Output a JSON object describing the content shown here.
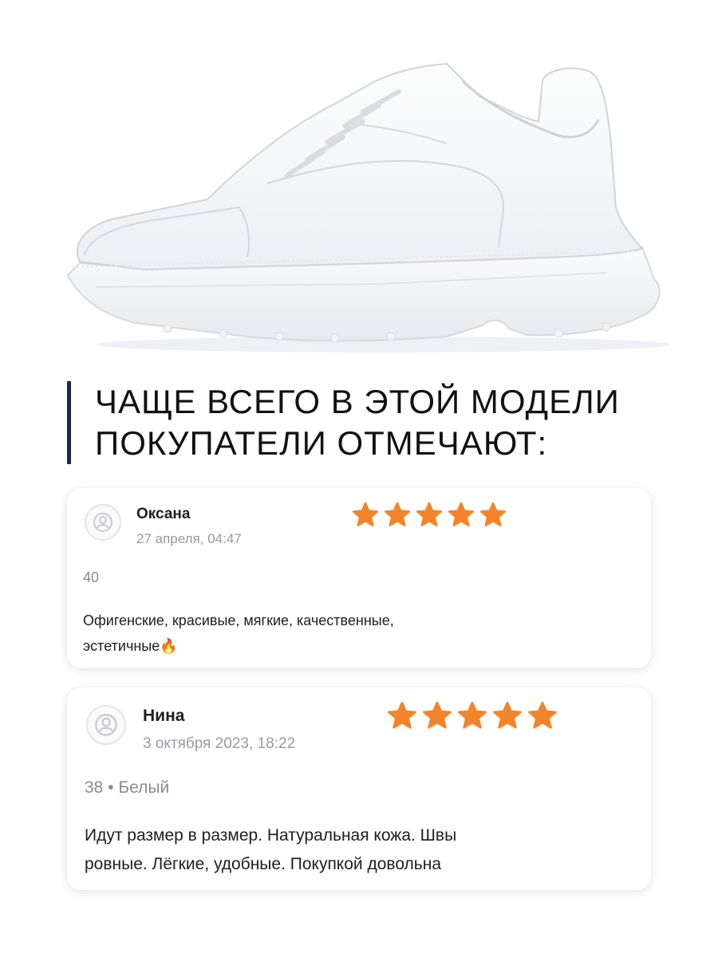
{
  "headline": {
    "line1": "ЧАЩЕ ВСЕГО В ЭТОЙ МОДЕЛИ",
    "line2": "ПОКУПАТЕЛИ ОТМЕЧАЮТ:"
  },
  "colors": {
    "accent_bar": "#1f2a44",
    "star": "#f4842b",
    "muted_text": "#9a9aa2"
  },
  "product": {
    "icon": "white-sneaker-photo"
  },
  "reviews": [
    {
      "name": "Оксана",
      "date": "27 апреля, 04:47",
      "rating": 5,
      "meta": "40",
      "text_line1": "Офигенские, красивые, мягкие, качественные,",
      "text_line2": "эстетичные",
      "emoji": "🔥"
    },
    {
      "name": "Нина",
      "date": "3 октября 2023, 18:22",
      "rating": 5,
      "meta": "38 • Белый",
      "text_line1": "Идут размер в размер. Натуральная кожа. Швы",
      "text_line2": "ровные. Лёгкие, удобные. Покупкой довольна"
    }
  ]
}
